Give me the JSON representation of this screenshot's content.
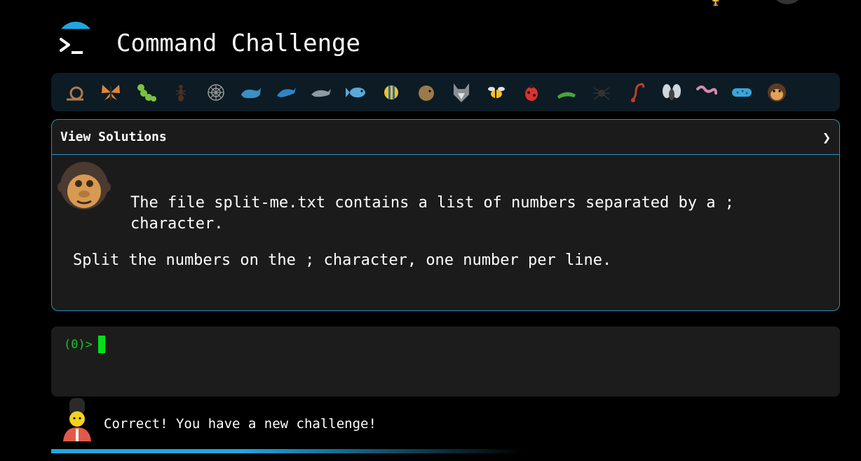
{
  "header": {
    "title": "Command Challenge",
    "logo_icon": "terminal-prompt-icon",
    "accent_color": "#1fa7e0"
  },
  "critters": [
    {
      "name": "snail"
    },
    {
      "name": "butterfly"
    },
    {
      "name": "caterpillar"
    },
    {
      "name": "ant"
    },
    {
      "name": "spider-web"
    },
    {
      "name": "whale"
    },
    {
      "name": "dolphin-blue"
    },
    {
      "name": "dolphin-gray"
    },
    {
      "name": "fish"
    },
    {
      "name": "tropical-fish"
    },
    {
      "name": "blowfish"
    },
    {
      "name": "wolf"
    },
    {
      "name": "bee"
    },
    {
      "name": "ladybug"
    },
    {
      "name": "cricket"
    },
    {
      "name": "spider"
    },
    {
      "name": "scorpion"
    },
    {
      "name": "fly"
    },
    {
      "name": "worm"
    },
    {
      "name": "microbe"
    },
    {
      "name": "monkey"
    }
  ],
  "card": {
    "header_label": "View Solutions",
    "chevron": "❯",
    "description": "The file split-me.txt contains a list of numbers separated by a ; character.",
    "task": "Split the numbers on the ; character, one number per line."
  },
  "terminal": {
    "prompt": "(0)>"
  },
  "footer": {
    "message": "Correct! You have a new challenge!",
    "progress_fraction": 0.55
  }
}
